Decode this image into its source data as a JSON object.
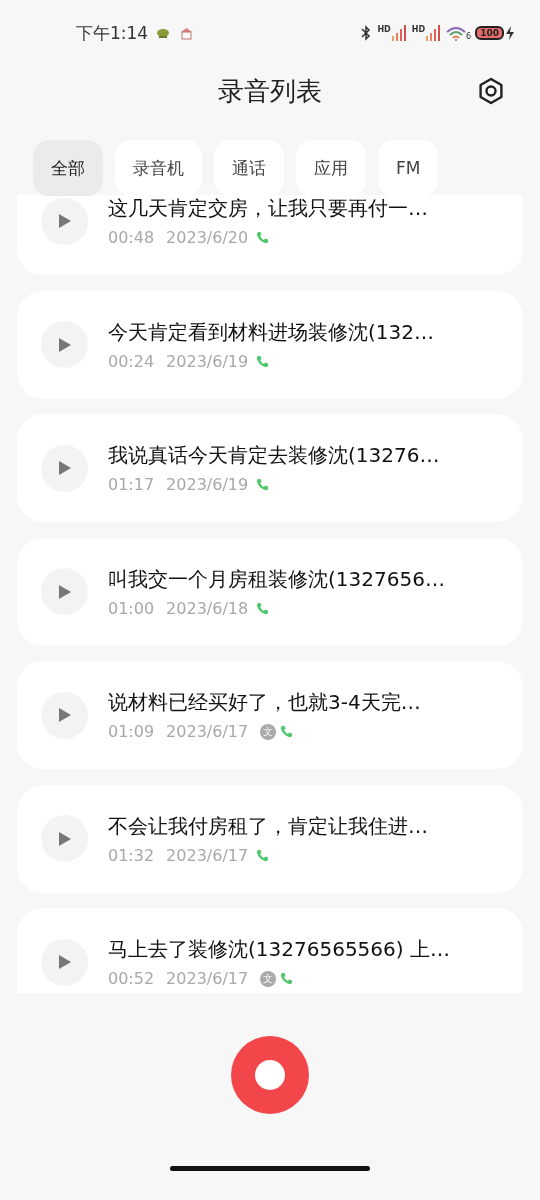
{
  "status_bar": {
    "time": "下午1:14",
    "signal_1_label": "HD",
    "signal_2_label": "HD",
    "wifi_label": "6",
    "battery": "100"
  },
  "header": {
    "title": "录音列表"
  },
  "tabs": [
    {
      "label": "全部",
      "selected": true
    },
    {
      "label": "录音机",
      "selected": false
    },
    {
      "label": "通话",
      "selected": false
    },
    {
      "label": "应用",
      "selected": false
    },
    {
      "label": "FM",
      "selected": false
    }
  ],
  "recordings": [
    {
      "title": "这几天肯定交房，让我只要再付一…",
      "duration": "00:48",
      "date": "2023/6/20",
      "kind": "call"
    },
    {
      "title": "今天肯定看到材料进场装修沈(132…",
      "duration": "00:24",
      "date": "2023/6/19",
      "kind": "call"
    },
    {
      "title": "我说真话今天肯定去装修沈(13276…",
      "duration": "01:17",
      "date": "2023/6/19",
      "kind": "call"
    },
    {
      "title": "叫我交一个月房租装修沈(1327656…",
      "duration": "01:00",
      "date": "2023/6/18",
      "kind": "call"
    },
    {
      "title": "说材料已经买好了，也就3-4天完…",
      "duration": "01:09",
      "date": "2023/6/17",
      "transcript_badge": "文",
      "kind": "call"
    },
    {
      "title": "不会让我付房租了，肯定让我住进…",
      "duration": "01:32",
      "date": "2023/6/17",
      "kind": "call"
    },
    {
      "title": "马上去了装修沈(13276565566) 上…",
      "duration": "00:52",
      "date": "2023/6/17",
      "transcript_badge": "文",
      "kind": "call"
    }
  ]
}
